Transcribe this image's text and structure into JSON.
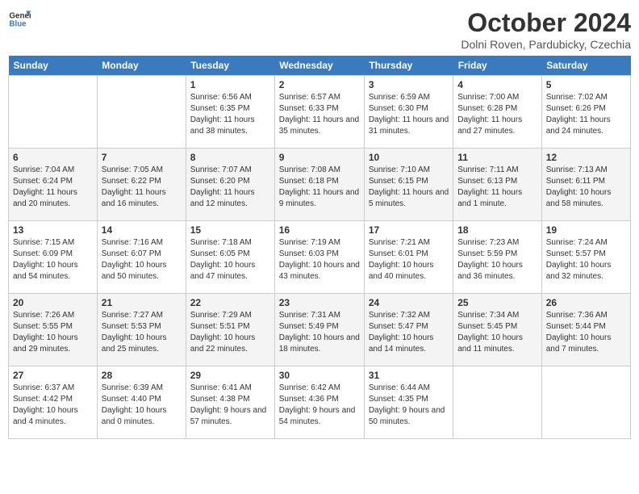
{
  "header": {
    "logo_general": "General",
    "logo_blue": "Blue",
    "month_title": "October 2024",
    "location": "Dolni Roven, Pardubicky, Czechia"
  },
  "days_of_week": [
    "Sunday",
    "Monday",
    "Tuesday",
    "Wednesday",
    "Thursday",
    "Friday",
    "Saturday"
  ],
  "weeks": [
    [
      {
        "num": "",
        "info": ""
      },
      {
        "num": "",
        "info": ""
      },
      {
        "num": "1",
        "info": "Sunrise: 6:56 AM\nSunset: 6:35 PM\nDaylight: 11 hours and 38 minutes."
      },
      {
        "num": "2",
        "info": "Sunrise: 6:57 AM\nSunset: 6:33 PM\nDaylight: 11 hours and 35 minutes."
      },
      {
        "num": "3",
        "info": "Sunrise: 6:59 AM\nSunset: 6:30 PM\nDaylight: 11 hours and 31 minutes."
      },
      {
        "num": "4",
        "info": "Sunrise: 7:00 AM\nSunset: 6:28 PM\nDaylight: 11 hours and 27 minutes."
      },
      {
        "num": "5",
        "info": "Sunrise: 7:02 AM\nSunset: 6:26 PM\nDaylight: 11 hours and 24 minutes."
      }
    ],
    [
      {
        "num": "6",
        "info": "Sunrise: 7:04 AM\nSunset: 6:24 PM\nDaylight: 11 hours and 20 minutes."
      },
      {
        "num": "7",
        "info": "Sunrise: 7:05 AM\nSunset: 6:22 PM\nDaylight: 11 hours and 16 minutes."
      },
      {
        "num": "8",
        "info": "Sunrise: 7:07 AM\nSunset: 6:20 PM\nDaylight: 11 hours and 12 minutes."
      },
      {
        "num": "9",
        "info": "Sunrise: 7:08 AM\nSunset: 6:18 PM\nDaylight: 11 hours and 9 minutes."
      },
      {
        "num": "10",
        "info": "Sunrise: 7:10 AM\nSunset: 6:15 PM\nDaylight: 11 hours and 5 minutes."
      },
      {
        "num": "11",
        "info": "Sunrise: 7:11 AM\nSunset: 6:13 PM\nDaylight: 11 hours and 1 minute."
      },
      {
        "num": "12",
        "info": "Sunrise: 7:13 AM\nSunset: 6:11 PM\nDaylight: 10 hours and 58 minutes."
      }
    ],
    [
      {
        "num": "13",
        "info": "Sunrise: 7:15 AM\nSunset: 6:09 PM\nDaylight: 10 hours and 54 minutes."
      },
      {
        "num": "14",
        "info": "Sunrise: 7:16 AM\nSunset: 6:07 PM\nDaylight: 10 hours and 50 minutes."
      },
      {
        "num": "15",
        "info": "Sunrise: 7:18 AM\nSunset: 6:05 PM\nDaylight: 10 hours and 47 minutes."
      },
      {
        "num": "16",
        "info": "Sunrise: 7:19 AM\nSunset: 6:03 PM\nDaylight: 10 hours and 43 minutes."
      },
      {
        "num": "17",
        "info": "Sunrise: 7:21 AM\nSunset: 6:01 PM\nDaylight: 10 hours and 40 minutes."
      },
      {
        "num": "18",
        "info": "Sunrise: 7:23 AM\nSunset: 5:59 PM\nDaylight: 10 hours and 36 minutes."
      },
      {
        "num": "19",
        "info": "Sunrise: 7:24 AM\nSunset: 5:57 PM\nDaylight: 10 hours and 32 minutes."
      }
    ],
    [
      {
        "num": "20",
        "info": "Sunrise: 7:26 AM\nSunset: 5:55 PM\nDaylight: 10 hours and 29 minutes."
      },
      {
        "num": "21",
        "info": "Sunrise: 7:27 AM\nSunset: 5:53 PM\nDaylight: 10 hours and 25 minutes."
      },
      {
        "num": "22",
        "info": "Sunrise: 7:29 AM\nSunset: 5:51 PM\nDaylight: 10 hours and 22 minutes."
      },
      {
        "num": "23",
        "info": "Sunrise: 7:31 AM\nSunset: 5:49 PM\nDaylight: 10 hours and 18 minutes."
      },
      {
        "num": "24",
        "info": "Sunrise: 7:32 AM\nSunset: 5:47 PM\nDaylight: 10 hours and 14 minutes."
      },
      {
        "num": "25",
        "info": "Sunrise: 7:34 AM\nSunset: 5:45 PM\nDaylight: 10 hours and 11 minutes."
      },
      {
        "num": "26",
        "info": "Sunrise: 7:36 AM\nSunset: 5:44 PM\nDaylight: 10 hours and 7 minutes."
      }
    ],
    [
      {
        "num": "27",
        "info": "Sunrise: 6:37 AM\nSunset: 4:42 PM\nDaylight: 10 hours and 4 minutes."
      },
      {
        "num": "28",
        "info": "Sunrise: 6:39 AM\nSunset: 4:40 PM\nDaylight: 10 hours and 0 minutes."
      },
      {
        "num": "29",
        "info": "Sunrise: 6:41 AM\nSunset: 4:38 PM\nDaylight: 9 hours and 57 minutes."
      },
      {
        "num": "30",
        "info": "Sunrise: 6:42 AM\nSunset: 4:36 PM\nDaylight: 9 hours and 54 minutes."
      },
      {
        "num": "31",
        "info": "Sunrise: 6:44 AM\nSunset: 4:35 PM\nDaylight: 9 hours and 50 minutes."
      },
      {
        "num": "",
        "info": ""
      },
      {
        "num": "",
        "info": ""
      }
    ]
  ]
}
